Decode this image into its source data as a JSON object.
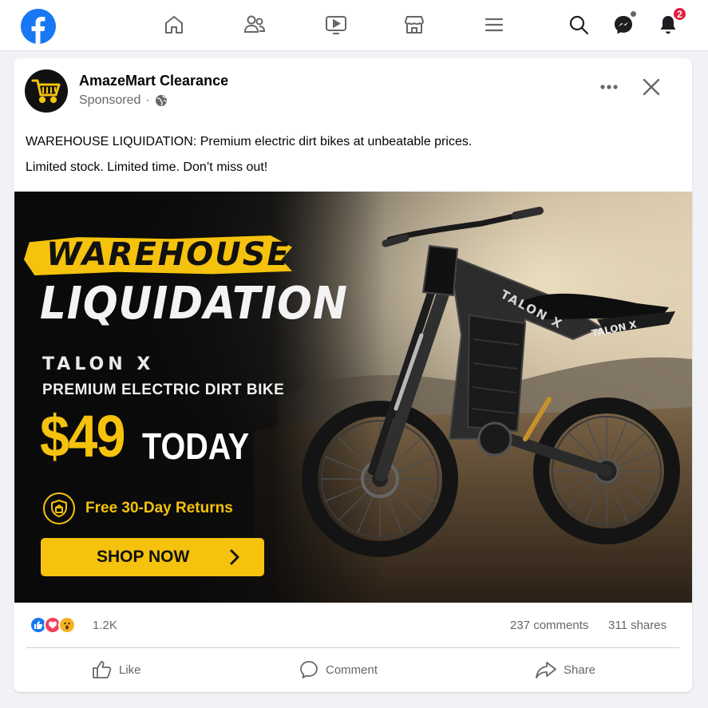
{
  "nav": {
    "logo_icon": "facebook-logo",
    "icons": [
      "home-icon",
      "friends-icon",
      "video-icon",
      "marketplace-icon",
      "menu-icon",
      "search-icon",
      "messenger-icon",
      "notifications-icon"
    ],
    "notification_count": "2"
  },
  "post": {
    "page_name": "AmazeMart Clearance",
    "sponsored": "Sponsored",
    "separator": "·",
    "text_line1": "WAREHOUSE LIQUIDATION: Premium electric dirt bikes at unbeatable prices.",
    "text_line2": "Limited stock. Limited time. Don’t miss out!"
  },
  "ad": {
    "headline1": "WAREHOUSE",
    "headline2": "LIQUIDATION",
    "brand": "TALON X",
    "subtitle": "PREMIUM ELECTRIC DIRT BIKE",
    "price": "$49",
    "today": "TODAY",
    "returns": "Free 30-Day Returns",
    "cta": "SHOP NOW",
    "frame_brand": "TALON X",
    "colors": {
      "accent": "#f5c20d",
      "dark": "#111111"
    }
  },
  "engagement": {
    "reaction_count": "1.2K",
    "comments": "237 comments",
    "shares": "311 shares",
    "reactions": [
      "like",
      "love",
      "wow"
    ]
  },
  "actions": {
    "like": "Like",
    "comment": "Comment",
    "share": "Share"
  },
  "colors": {
    "brand": "#1877f2",
    "badge": "#e41e3f",
    "muted": "#65676b"
  }
}
